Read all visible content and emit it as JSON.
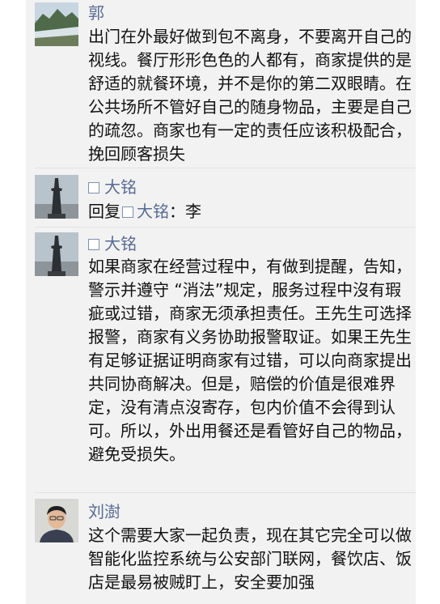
{
  "comments": [
    {
      "author": "郭",
      "avatar": "landscape-avatar",
      "text": "出门在外最好做到包不离身，不要离开自己的视线。餐厅形形色色的人都有，商家提供的是舒适的就餐环境，并不是你的第二双眼睛。在公共场所不管好自己的随身物品，主要是自己的疏忽。商家也有一定的责任应该积极配合，挽回顾客损失"
    },
    {
      "author": "大铭",
      "avatar": "tower-avatar",
      "reply_prefix": "回复",
      "reply_to": "大铭",
      "reply_sep": "：",
      "text": "李"
    },
    {
      "author": "大铭",
      "avatar": "tower-avatar",
      "text": "如果商家在经营过程中，有做到提醒，告知，警示并遵守 “消法”规定，服务过程中沒有瑕疵或过错，商家无须承担责任。王先生可选择报警，商家有义务协助报警取证。如果王先生有足够证据证明商家有过错，可以向商家提出共同协商解决。但是，赔偿的价值是很难界定，没有清点沒寄存，包内价值不会得到认可。所以，外出用餐还是看管好自己的物品，避免受损失。"
    },
    {
      "author": "刘澍",
      "avatar": "person-avatar",
      "text": "这个需要大家一起负责，现在其它完全可以做智能化监控系统与公安部门联网，餐饮店、饭店是最易被贼盯上，安全要加强"
    }
  ]
}
